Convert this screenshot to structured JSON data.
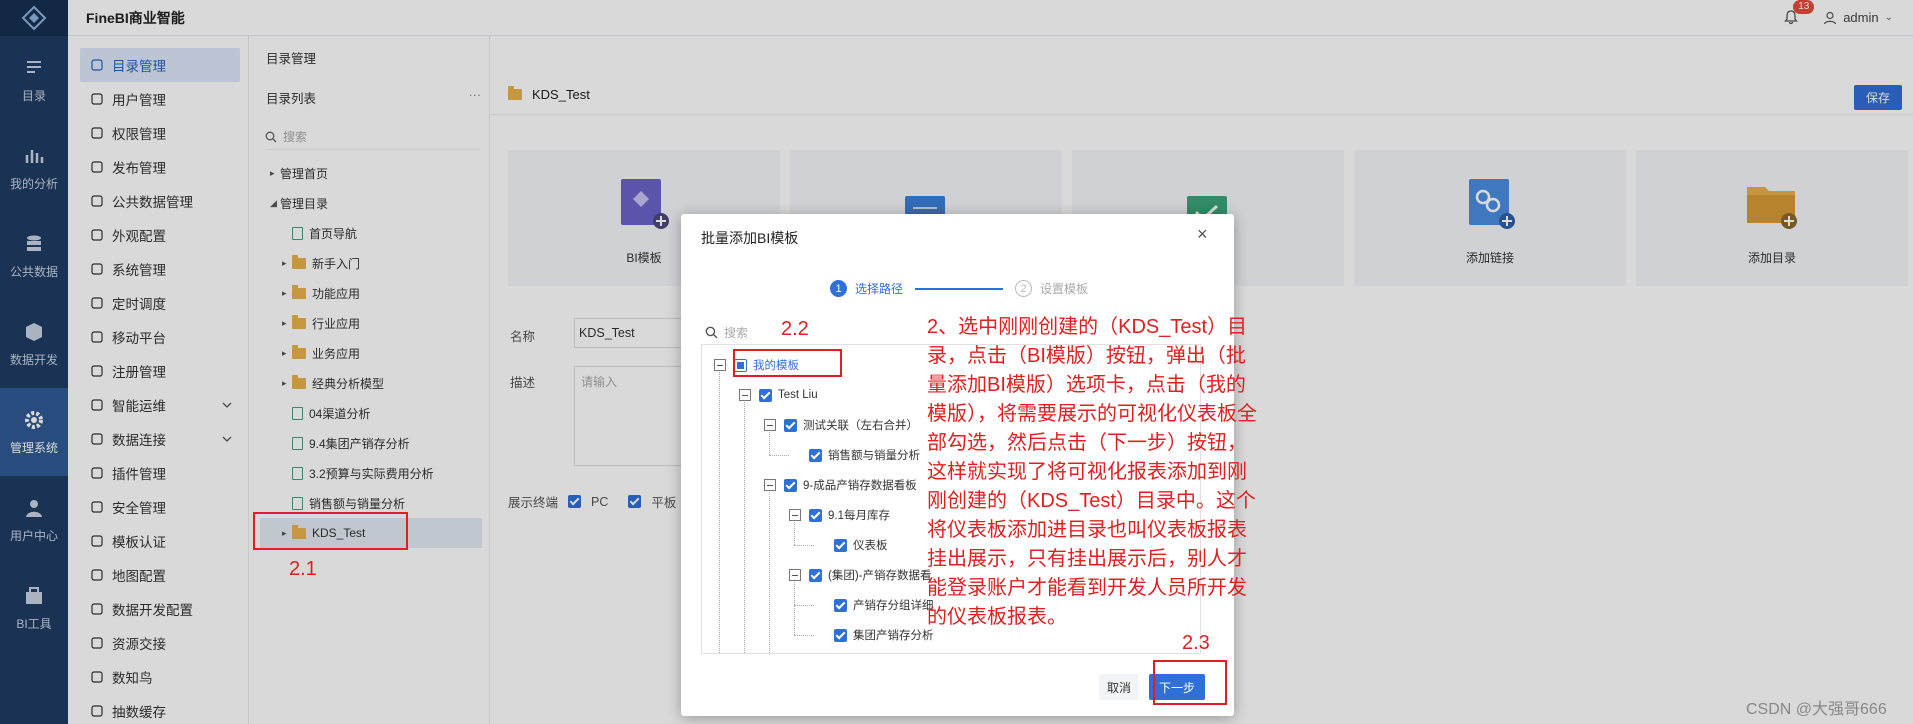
{
  "app": {
    "brand": "FineBI商业智能",
    "notifications": "13",
    "user": "admin"
  },
  "leftnav": [
    {
      "label": "目录",
      "icon": "catalog-icon"
    },
    {
      "label": "我的分析",
      "icon": "analysis-icon"
    },
    {
      "label": "公共数据",
      "icon": "database-icon"
    },
    {
      "label": "数据开发",
      "icon": "dev-icon"
    },
    {
      "label": "管理系统",
      "icon": "gear-icon"
    },
    {
      "label": "用户中心",
      "icon": "user-icon"
    },
    {
      "label": "BI工具",
      "icon": "toolbox-icon"
    }
  ],
  "sidemenu": [
    {
      "label": "目录管理",
      "active": true
    },
    {
      "label": "用户管理"
    },
    {
      "label": "权限管理"
    },
    {
      "label": "发布管理"
    },
    {
      "label": "公共数据管理"
    },
    {
      "label": "外观配置"
    },
    {
      "label": "系统管理"
    },
    {
      "label": "定时调度"
    },
    {
      "label": "移动平台"
    },
    {
      "label": "注册管理"
    },
    {
      "label": "智能运维",
      "expandable": true
    },
    {
      "label": "数据连接",
      "expandable": true
    },
    {
      "label": "插件管理"
    },
    {
      "label": "安全管理"
    },
    {
      "label": "模板认证"
    },
    {
      "label": "地图配置"
    },
    {
      "label": "数据开发配置"
    },
    {
      "label": "资源交接"
    },
    {
      "label": "数知鸟"
    },
    {
      "label": "抽数缓存"
    }
  ],
  "catalog": {
    "breadcrumb": "目录管理",
    "title": "目录列表",
    "more": "···",
    "search_placeholder": "搜索",
    "tree": [
      {
        "label": "管理首页",
        "level": 0,
        "type": "caret"
      },
      {
        "label": "管理目录",
        "level": 0,
        "type": "caret-open"
      },
      {
        "label": "首页导航",
        "level": 1,
        "type": "doc"
      },
      {
        "label": "新手入门",
        "level": 1,
        "type": "folder"
      },
      {
        "label": "功能应用",
        "level": 1,
        "type": "folder"
      },
      {
        "label": "行业应用",
        "level": 1,
        "type": "folder"
      },
      {
        "label": "业务应用",
        "level": 1,
        "type": "folder"
      },
      {
        "label": "经典分析模型",
        "level": 1,
        "type": "folder"
      },
      {
        "label": "04渠道分析",
        "level": 1,
        "type": "doc"
      },
      {
        "label": "9.4集团产销存分析",
        "level": 1,
        "type": "doc"
      },
      {
        "label": "3.2预算与实际费用分析",
        "level": 1,
        "type": "doc"
      },
      {
        "label": "销售额与销量分析",
        "level": 1,
        "type": "doc"
      },
      {
        "label": "KDS_Test",
        "level": 1,
        "type": "folder",
        "selected": true
      }
    ]
  },
  "main": {
    "folder_name": "KDS_Test",
    "save": "保存",
    "cards": [
      "BI模板",
      "",
      "",
      "添加链接",
      "添加目录"
    ],
    "name_label": "名称",
    "name_value": "KDS_Test",
    "desc_label": "描述",
    "desc_placeholder": "请输入",
    "terminal_label": "展示终端",
    "terminal_pc": "PC",
    "terminal_pad": "平板"
  },
  "dialog": {
    "title": "批量添加BI模板",
    "close": "×",
    "step1": "选择路径",
    "step2": "设置模板",
    "step1_num": "1",
    "step2_num": "2",
    "search_placeholder": "搜索",
    "tree": {
      "n0": "我的模板",
      "n1": "Test Liu",
      "n2": "测试关联（左右合并）",
      "n3": "销售额与销量分析",
      "n4": "9-成品产销存数据看板",
      "n5": "9.1每月库存",
      "n6": "仪表板",
      "n7": "(集团)-产销存数据看",
      "n8": "产销存分组详细",
      "n9": "集团产销存分析"
    },
    "cancel": "取消",
    "next": "下一步"
  },
  "annotations": {
    "a21": "2.1",
    "a22": "2.2",
    "a23": "2.3",
    "text": "2、选中刚刚创建的（KDS_Test）目录，点击（BI模版）按钮，弹出（批量添加BI模版）选项卡，点击（我的模版），将需要展示的可视化仪表板全部勾选，然后点击（下一步）按钮，这样就实现了将可视化报表添加到刚刚创建的（KDS_Test）目录中。这个将仪表板添加进目录也叫仪表板报表挂出展示，只有挂出展示后，别人才能登录账户才能看到开发人员所开发的仪表板报表。"
  },
  "watermark": "CSDN @大强哥666"
}
